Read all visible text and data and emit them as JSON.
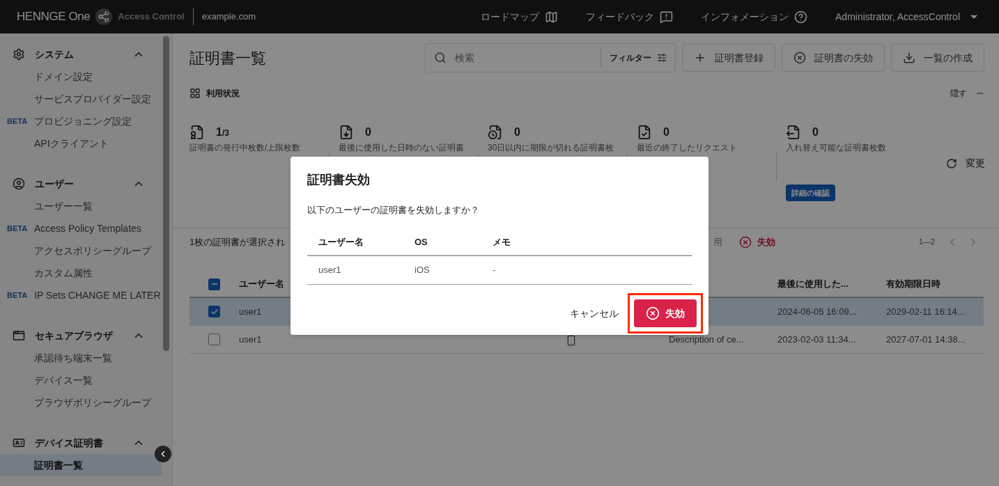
{
  "header": {
    "brand": "HENNGE One",
    "product": "Access Control",
    "domain": "example.com",
    "nav": [
      {
        "label": "ロードマップ"
      },
      {
        "label": "フィードバック"
      },
      {
        "label": "インフォメーション"
      }
    ],
    "user": "Administrator, AccessControl"
  },
  "sidebar": {
    "sections": [
      {
        "title": "システム",
        "expanded": true,
        "items": [
          {
            "label": "ドメイン設定",
            "selected": false
          },
          {
            "label": "サービスプロバイダー設定",
            "selected": false
          },
          {
            "label": "プロビジョニング設定",
            "tag": "BETA",
            "selected": false
          },
          {
            "label": "APIクライアント",
            "selected": false
          }
        ]
      },
      {
        "title": "ユーザー",
        "expanded": true,
        "items": [
          {
            "label": "ユーザー一覧",
            "selected": false
          },
          {
            "label": "Access Policy Templates",
            "tag": "BETA",
            "selected": false
          },
          {
            "label": "アクセスポリシーグループ",
            "selected": false
          },
          {
            "label": "カスタム属性",
            "selected": false
          },
          {
            "label": "IP Sets CHANGE ME LATER",
            "tag": "BETA",
            "selected": false
          }
        ]
      },
      {
        "title": "セキュアブラウザ",
        "expanded": true,
        "items": [
          {
            "label": "承認待ち端末一覧",
            "selected": false
          },
          {
            "label": "デバイス一覧",
            "selected": false
          },
          {
            "label": "ブラウザポリシーグループ",
            "selected": false
          }
        ]
      },
      {
        "title": "デバイス証明書",
        "expanded": true,
        "items": [
          {
            "label": "証明書一覧",
            "selected": true
          }
        ]
      }
    ]
  },
  "main": {
    "title": "証明書一覧",
    "search": {
      "placeholder": "検索"
    },
    "filter": "フィルター",
    "actions": [
      {
        "label": "証明書登録"
      },
      {
        "label": "証明書の失効"
      },
      {
        "label": "一覧の作成"
      }
    ],
    "usage": {
      "title": "利用状況",
      "hide": "隠す",
      "stats": [
        {
          "value": "1",
          "total": "/3",
          "label": "証明書の発行中枚数/上限枚数"
        },
        {
          "value": "0",
          "label": "最後に使用した日時のない証明書"
        },
        {
          "value": "0",
          "label": "30日以内に期限が切れる証明書枚"
        },
        {
          "value": "0",
          "label": "最近の終了したリクエスト"
        },
        {
          "value": "0",
          "label": "入れ替え可能な証明書枚数"
        }
      ],
      "change": "変更",
      "details": "詳細の確認"
    },
    "selection_bar": {
      "text": "1枚の証明書が選択され",
      "partial_action": "用",
      "revoke": "失効",
      "pager": "1—2"
    },
    "table": {
      "select_all_indeterminate": true,
      "columns": [
        "ユーザー名",
        null,
        null,
        null,
        null,
        "最後に使用した...",
        "有効期限日時"
      ],
      "rows": [
        {
          "selected": true,
          "checked": true,
          "cells": [
            "user1",
            null,
            null,
            null,
            null,
            "2024-06-05 16:09...",
            "2029-02-11 16:14..."
          ]
        },
        {
          "selected": false,
          "checked": false,
          "cells": [
            "user1",
            null,
            null,
            {
              "kind": "icon"
            },
            "Description of ce...",
            "2023-02-03 11:34...",
            "2027-07-01 14:38..."
          ]
        }
      ]
    }
  },
  "dialog": {
    "title": "証明書失効",
    "message": "以下のユーザーの証明書を失効しますか？",
    "columns": [
      "ユーザー名",
      "OS",
      "メモ"
    ],
    "rows": [
      [
        "user1",
        "iOS",
        "-"
      ]
    ],
    "cancel": "キャンセル",
    "confirm": "失効",
    "confirm_highlighted": true
  }
}
